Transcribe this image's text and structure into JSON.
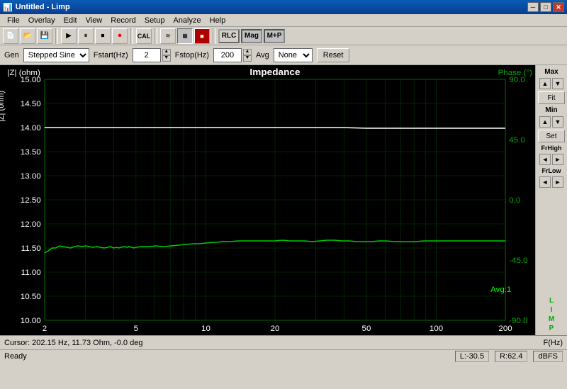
{
  "window": {
    "title": "Untitled - Limp",
    "titlebar_icon": "♦"
  },
  "menubar": {
    "items": [
      "File",
      "Overlay",
      "Edit",
      "View",
      "Record",
      "Setup",
      "Analyze",
      "Help"
    ]
  },
  "toolbar1": {
    "buttons": [
      "new",
      "open",
      "save",
      "separator",
      "play-pause",
      "stop",
      "record",
      "separator",
      "cal",
      "separator",
      "wave1",
      "wave2",
      "wave3"
    ]
  },
  "toolbar2": {
    "rlc_label": "RLC",
    "mag_label": "Mag",
    "mp_label": "M+P"
  },
  "toolbar3": {
    "gen_label": "Gen",
    "gen_type": "Stepped Sine",
    "fstart_label": "Fstart(Hz)",
    "fstart_value": "2",
    "fstop_label": "Fstop(Hz)",
    "fstop_value": "200",
    "avg_label": "Avg",
    "avg_value": "None",
    "reset_label": "Reset"
  },
  "chart": {
    "title": "Impedance",
    "y_left_label": "|Z| (ohm)",
    "y_right_label": "Phase (°)",
    "x_label": "F(Hz)",
    "y_left_max": "15.00",
    "y_left_min": "10.00",
    "y_right_values": [
      "90.0",
      "45.0",
      "0.0",
      "-45.0",
      "-90.0"
    ],
    "y_left_values": [
      "15.00",
      "14.50",
      "14.00",
      "13.50",
      "13.00",
      "12.50",
      "12.00",
      "11.50",
      "11.00",
      "10.50",
      "10.00"
    ],
    "x_values": [
      "2",
      "5",
      "10",
      "20",
      "50",
      "100",
      "200"
    ],
    "avg_indicator": "Avg:1"
  },
  "right_panel": {
    "max_label": "Max",
    "fit_label": "Fit",
    "min_label": "Min",
    "set_label": "Set",
    "frhigh_label": "FrHigh",
    "frlow_label": "FrLow"
  },
  "statusbar": {
    "ready": "Ready"
  },
  "infobar": {
    "cursor_info": "Cursor: 202.15 Hz, 11.73 Ohm, -0.0 deg",
    "f_label": "F(Hz)",
    "l_label": "L",
    "r_label": "R:62.4",
    "left_val": "L:-30.5",
    "dbfs_label": "dBFS"
  }
}
